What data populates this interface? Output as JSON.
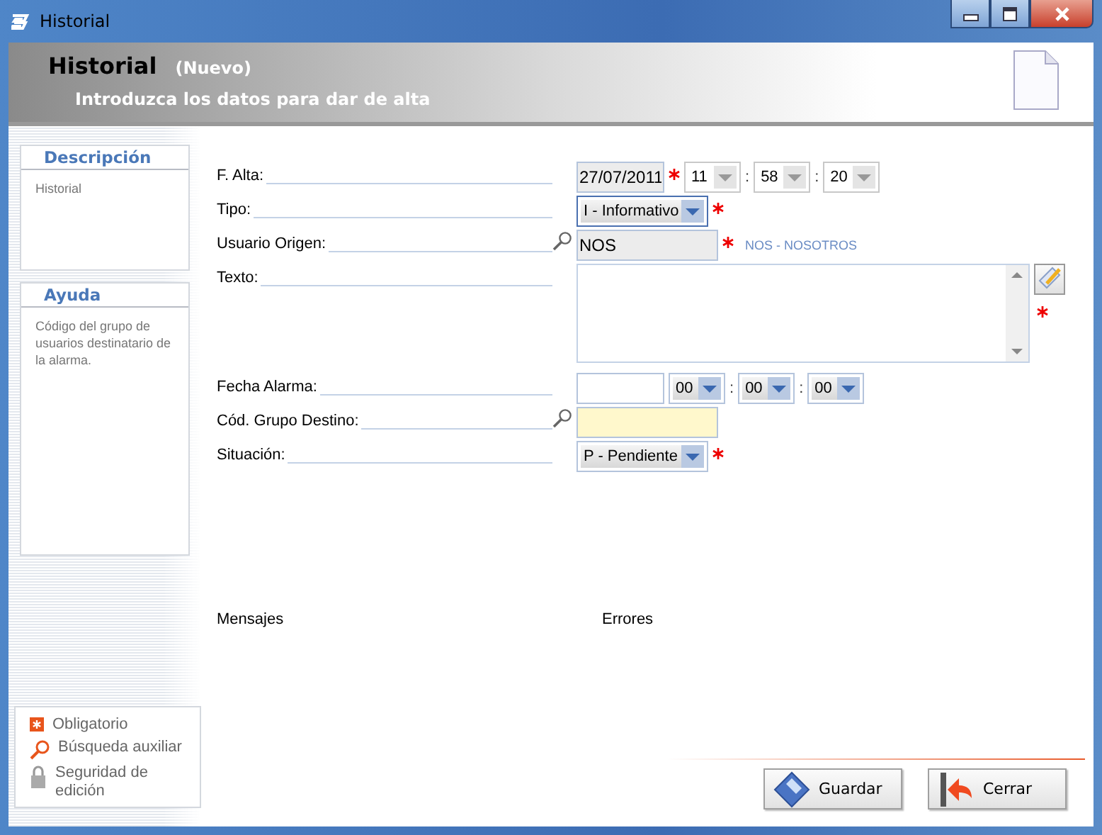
{
  "window": {
    "title": "Historial"
  },
  "header": {
    "title": "Historial",
    "state": "(Nuevo)",
    "subtitle": "Introduzca los datos para dar de alta"
  },
  "description": {
    "heading": "Descripción",
    "text": "Historial"
  },
  "help": {
    "heading": "Ayuda",
    "text": "Código del grupo de usuarios destinatario de la alarma."
  },
  "fields": [
    {
      "kind": "datetime",
      "label": "F. Alta:",
      "date": "27/07/2011",
      "required": true,
      "disabled": true,
      "time": [
        {
          "value": "11"
        },
        {
          "sep": ":",
          "value": "58"
        },
        {
          "sep": ":",
          "value": "20"
        }
      ]
    },
    {
      "kind": "select",
      "label": "Tipo:",
      "value": "I - Informativo",
      "required": true,
      "focused": true
    },
    {
      "kind": "lookup",
      "label": "Usuario Origen:",
      "value": "NOS",
      "required": true,
      "disabled": true,
      "highlighted": false,
      "description": "NOS - NOSOTROS"
    },
    {
      "kind": "textarea",
      "label": "Texto:",
      "required": true
    },
    {
      "kind": "datetime",
      "label": "Fecha Alarma:",
      "required": false,
      "disabled": false,
      "time": [
        {
          "value": "00"
        },
        {
          "sep": ":",
          "value": "00"
        },
        {
          "sep": ":",
          "value": "00"
        }
      ]
    },
    {
      "kind": "lookup",
      "label": "Cód. Grupo Destino:",
      "required": false,
      "disabled": false,
      "highlighted": true
    },
    {
      "kind": "select",
      "label": "Situación:",
      "value": "P - Pendiente",
      "required": true,
      "focused": false
    }
  ],
  "messages": {
    "label": "Mensajes"
  },
  "errors": {
    "label": "Errores"
  },
  "legend": [
    {
      "kind": "required",
      "label": "Obligatorio"
    },
    {
      "kind": "search",
      "label": "Búsqueda auxiliar"
    },
    {
      "kind": "lock",
      "label": "Seguridad de edición"
    }
  ],
  "buttons": [
    {
      "kind": "save",
      "label": "Guardar"
    },
    {
      "kind": "close",
      "label": "Cerrar"
    }
  ]
}
